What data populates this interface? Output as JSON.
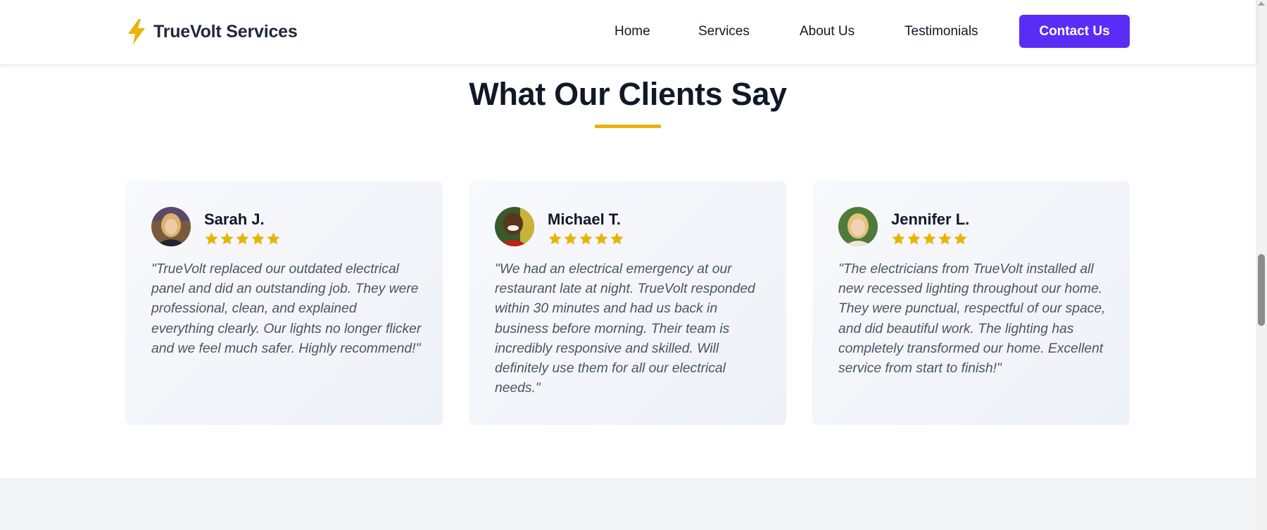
{
  "header": {
    "brand": "TrueVolt Services",
    "logo_icon": "lightning-bolt-icon",
    "nav": [
      "Home",
      "Services",
      "About Us",
      "Testimonials"
    ],
    "cta_label": "Contact Us",
    "accent_color": "#5b2cf5",
    "brand_color": "#eab308"
  },
  "testimonials": {
    "title": "What Our Clients Say",
    "items": [
      {
        "name": "Sarah J.",
        "rating": 5,
        "quote": "\"TrueVolt replaced our outdated electrical panel and did an outstanding job. They were professional, clean, and explained everything clearly. Our lights no longer flicker and we feel much safer. Highly recommend!\""
      },
      {
        "name": "Michael T.",
        "rating": 5,
        "quote": "\"We had an electrical emergency at our restaurant late at night. TrueVolt responded within 30 minutes and had us back in business before morning. Their team is incredibly responsive and skilled. Will definitely use them for all our electrical needs.\""
      },
      {
        "name": "Jennifer L.",
        "rating": 5,
        "quote": "\"The electricians from TrueVolt installed all new recessed lighting throughout our home. They were punctual, respectful of our space, and did beautiful work. The lighting has completely transformed our home. Excellent service from start to finish!\""
      }
    ]
  }
}
